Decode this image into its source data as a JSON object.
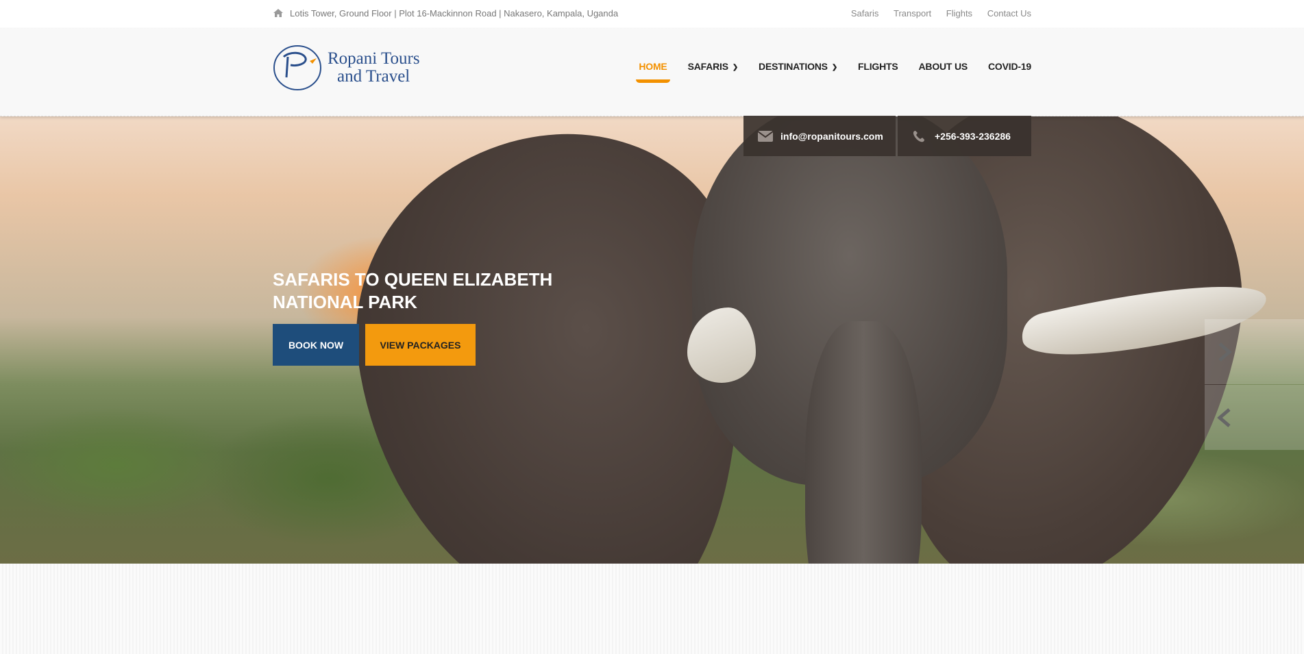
{
  "topbar": {
    "address": "Lotis Tower, Ground Floor | Plot 16-Mackinnon Road | Nakasero, Kampala, Uganda",
    "links": [
      "Safaris",
      "Transport",
      "Flights",
      "Contact Us"
    ]
  },
  "logo": {
    "script": "Ropani",
    "brand_line1": "Ropani Tours",
    "brand_line2": "and Travel",
    "tagline": "Tours & Travel"
  },
  "nav": {
    "home": "HOME",
    "safaris": "SAFARIS",
    "destinations": "DESTINATIONS",
    "flights": "FLIGHTS",
    "about": "ABOUT US",
    "covid": "COVID-19"
  },
  "contact": {
    "email": "info@ropanitours.com",
    "phone": "+256-393-236286"
  },
  "slide": {
    "title": "SAFARIS TO QUEEN ELIZABETH NATIONAL PARK",
    "book_label": "BOOK NOW",
    "packages_label": "VIEW PACKAGES"
  },
  "colors": {
    "accent": "#f39100",
    "primary": "#1e4d7b",
    "brand": "#2a4f8c"
  },
  "icons": [
    "home-icon",
    "chevron-down-icon",
    "envelope-icon",
    "phone-icon",
    "chevron-right-icon",
    "chevron-left-icon"
  ]
}
